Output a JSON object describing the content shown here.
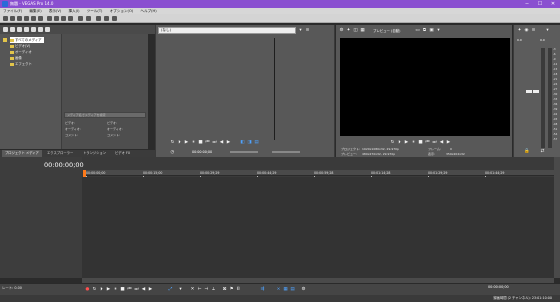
{
  "window": {
    "title": "無題 - VEGAS Pro 14.0",
    "minimize": "─",
    "maximize": "☐",
    "close": "✕"
  },
  "menu": [
    "ファイル(F)",
    "編集(E)",
    "表示(V)",
    "挿入(I)",
    "ツール(T)",
    "オプション(O)",
    "ヘルプ(H)"
  ],
  "explorer": {
    "tree": [
      {
        "label": "すべてのメディア",
        "selected": true
      },
      {
        "label": "ビデオ(V)",
        "selected": false
      },
      {
        "label": "オーディオ",
        "selected": false
      },
      {
        "label": "画像",
        "selected": false
      },
      {
        "label": "エフェクト",
        "selected": false
      }
    ],
    "search_placeholder": "メディア名でメディアを検索",
    "info": [
      {
        "key": "ビデオ:",
        "val": "ビデオ:"
      },
      {
        "key": "オーディオ:",
        "val": "オーディオ:"
      },
      {
        "key": "コメント:",
        "val": "コメント:"
      }
    ]
  },
  "tabs": [
    "プロジェクト メディア",
    "エクスプローラー",
    "トランジション",
    "ビデオ FX"
  ],
  "trimmer": {
    "source": "(なし)",
    "time": "00:00:00;00"
  },
  "preview": {
    "quality": "プレビュー (自動)",
    "project_label": "プロジェクト:",
    "project_val": "1920x1080x32, 29.970p",
    "preview_label": "プレビュー:",
    "preview_val": "480x270x32, 29.970p",
    "frame_label": "フレーム:",
    "frame_val": "0",
    "display_label": "表示:",
    "display_val": "359x202x32"
  },
  "master": {
    "scale": [
      "-3",
      "-6",
      "-9",
      "-12",
      "-15",
      "-18",
      "-21",
      "-24",
      "-27",
      "-30",
      "-33",
      "-36",
      "-39",
      "-42",
      "-45",
      "-48",
      "-51",
      "-54",
      "-57"
    ],
    "level_left": "0.0",
    "level_right": "0.0"
  },
  "timeline": {
    "timecode": "00:00:00;00",
    "ruler": [
      "00:00:00;00",
      "00:00:15;00",
      "00:00:29;29",
      "00:00:44;29",
      "00:00:59;28",
      "00:01:14;28",
      "00:01:29;29",
      "00:01:44;29"
    ]
  },
  "bottom": {
    "rate": "レート: 0.00",
    "time_right": "00:00:00;00"
  },
  "status": {
    "text": "録画時間 (2 チャンネル): 23:01:10:00"
  }
}
